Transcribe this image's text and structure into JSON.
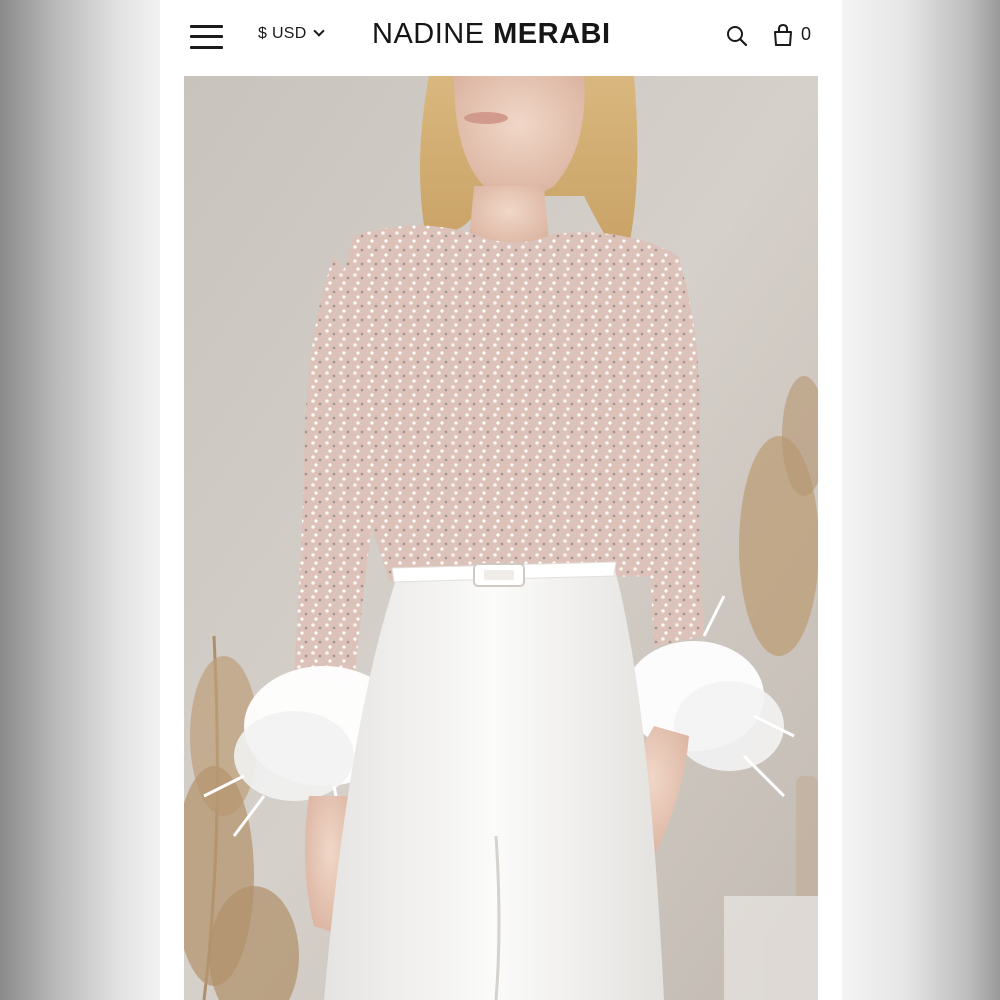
{
  "header": {
    "menu_icon": "hamburger-menu-icon",
    "currency_label": "$ USD",
    "brand_first": "NADINE",
    "brand_second": "MERABI",
    "search_icon": "search-icon",
    "bag_icon": "shopping-bag-icon",
    "cart_count": "0"
  },
  "product_image": {
    "alt": "Model wearing sheer embellished long-sleeve top with white feather cuffs and white belted trousers"
  },
  "colors": {
    "background": "#ffffff",
    "text": "#1a1a1a",
    "photo_wall": "#cfc7c1"
  }
}
